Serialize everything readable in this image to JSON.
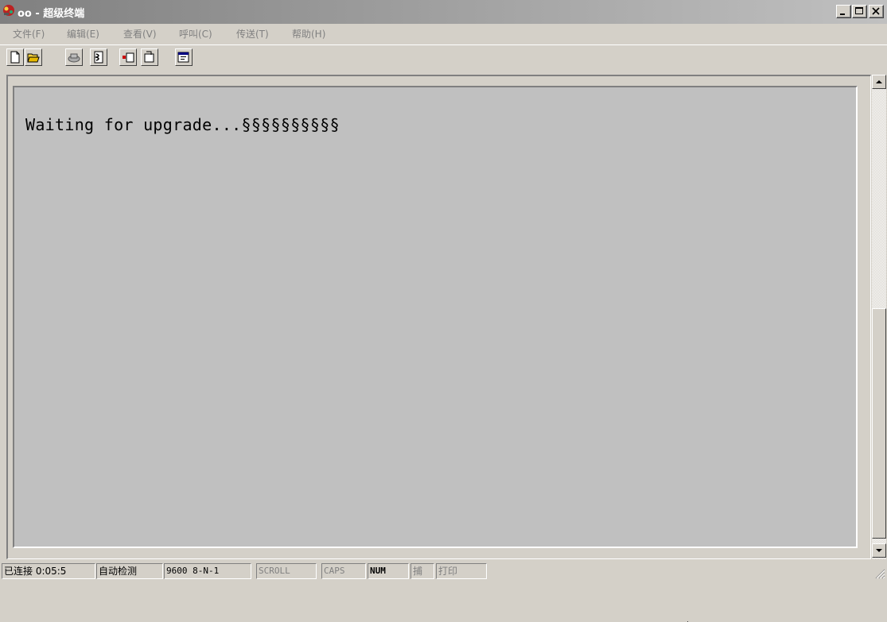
{
  "window": {
    "title": "oo - 超级终端"
  },
  "menu": {
    "items": [
      {
        "label": "文件(F)"
      },
      {
        "label": "编辑(E)"
      },
      {
        "label": "查看(V)"
      },
      {
        "label": "呼叫(C)"
      },
      {
        "label": "传送(T)"
      },
      {
        "label": "帮助(H)"
      }
    ]
  },
  "toolbar": {
    "icons": [
      "new-icon",
      "open-icon",
      "disconnect-icon",
      "connect-icon",
      "send-icon",
      "receive-icon",
      "properties-icon"
    ]
  },
  "terminal": {
    "text": "Waiting for upgrade...§§§§§§§§§§",
    "background": "#c0c0c0"
  },
  "statusbar": {
    "connected": "已连接 0:05:5",
    "detect": "自动检测",
    "port_settings": "9600 8-N-1",
    "scroll": "SCROLL",
    "caps": "CAPS",
    "num": "NUM",
    "capture": "捕",
    "print": "打印"
  },
  "colors": {
    "chrome": "#d4d0c8",
    "titlebar_inactive": "#808080"
  }
}
